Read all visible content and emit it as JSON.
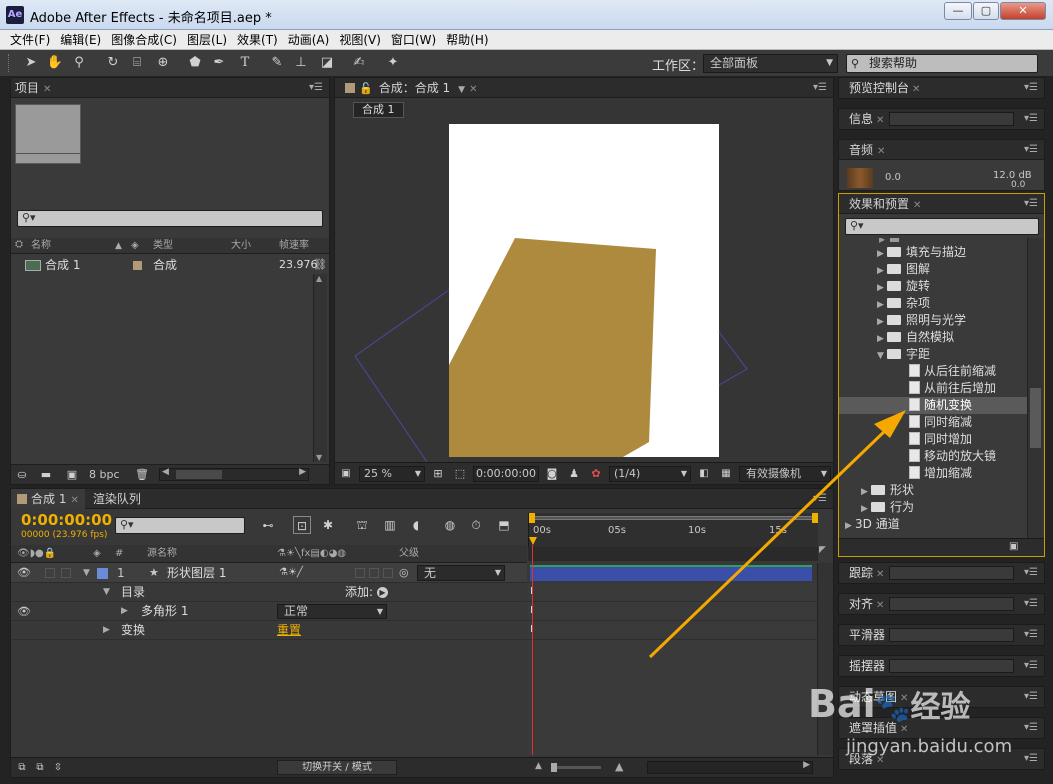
{
  "window": {
    "title": "Adobe After Effects - 未命名项目.aep *",
    "logo": "Ae",
    "min": "—",
    "max": "▢",
    "close": "✕"
  },
  "menu": [
    "文件(F)",
    "编辑(E)",
    "图像合成(C)",
    "图层(L)",
    "效果(T)",
    "动画(A)",
    "视图(V)",
    "窗口(W)",
    "帮助(H)"
  ],
  "toolbar": {
    "workspace_label": "工作区：",
    "workspace_value": "全部面板",
    "search_placeholder": "搜索帮助"
  },
  "project": {
    "tab": "项目",
    "search_placeholder": "",
    "columns": [
      "名称",
      "类型",
      "大小",
      "帧速率"
    ],
    "items": [
      {
        "name": "合成 1",
        "type": "合成",
        "fps": "23.976"
      }
    ],
    "footer_bpc": "8 bpc"
  },
  "composition": {
    "tab": "合成：合成 1",
    "breadcrumb": "合成 1",
    "zoom": "25 %",
    "timecode": "0:00:00:00",
    "resolution": "(1/4)",
    "camera": "有效摄像机"
  },
  "timeline": {
    "tabs": [
      "合成 1",
      "渲染队列"
    ],
    "timecode": "0:00:00:00",
    "frames_fps": "00000 (23.976 fps)",
    "col_source": "源名称",
    "col_parent": "父级",
    "ruler": [
      "00s",
      "05s",
      "10s",
      "15s"
    ],
    "layer": {
      "num": "1",
      "name": "形状图层 1",
      "parent": "无"
    },
    "contents_label": "目录",
    "add_label": "添加:",
    "polygon": "多角形 1",
    "blend": "正常",
    "transform": "变换",
    "reset": "重置",
    "footer": "切换开关 / 模式"
  },
  "right_panels": {
    "preview": "预览控制台",
    "info": "信息",
    "audio": "音频",
    "audio_left": "0.0",
    "audio_right": "12.0 dB",
    "audio_right2": "0.0",
    "effects": "效果和预置",
    "effects_tree": [
      {
        "label": "填充与描边",
        "kind": "folder",
        "depth": 1,
        "open": false
      },
      {
        "label": "图解",
        "kind": "folder",
        "depth": 1,
        "open": false
      },
      {
        "label": "旋转",
        "kind": "folder",
        "depth": 1,
        "open": false
      },
      {
        "label": "杂项",
        "kind": "folder",
        "depth": 1,
        "open": false
      },
      {
        "label": "照明与光学",
        "kind": "folder",
        "depth": 1,
        "open": false
      },
      {
        "label": "自然模拟",
        "kind": "folder",
        "depth": 1,
        "open": false
      },
      {
        "label": "字距",
        "kind": "folder",
        "depth": 1,
        "open": true
      },
      {
        "label": "从后往前缩减",
        "kind": "preset",
        "depth": 2
      },
      {
        "label": "从前往后增加",
        "kind": "preset",
        "depth": 2
      },
      {
        "label": "随机变换",
        "kind": "preset",
        "depth": 2,
        "selected": true
      },
      {
        "label": "同时缩减",
        "kind": "preset",
        "depth": 2
      },
      {
        "label": "同时增加",
        "kind": "preset",
        "depth": 2
      },
      {
        "label": "移动的放大镜",
        "kind": "preset",
        "depth": 2
      },
      {
        "label": "增加缩减",
        "kind": "preset",
        "depth": 2
      },
      {
        "label": "形状",
        "kind": "folder",
        "depth": 0,
        "open": false
      },
      {
        "label": "行为",
        "kind": "folder",
        "depth": 0,
        "open": false
      },
      {
        "label": "3D 通道",
        "kind": "category",
        "depth": -1
      }
    ],
    "more": [
      "跟踪",
      "对齐",
      "平滑器",
      "摇摆器",
      "动态草图",
      "遮罩插值",
      "段落"
    ]
  },
  "watermark": {
    "brand": "Bai",
    "brand2": "经验",
    "url": "jingyan.baidu.com"
  },
  "colors": {
    "accent": "#f0b000",
    "shape": "#ad8a3e",
    "layer_bar": "#3b4fa8",
    "selected_row": "#5a5a5a"
  }
}
